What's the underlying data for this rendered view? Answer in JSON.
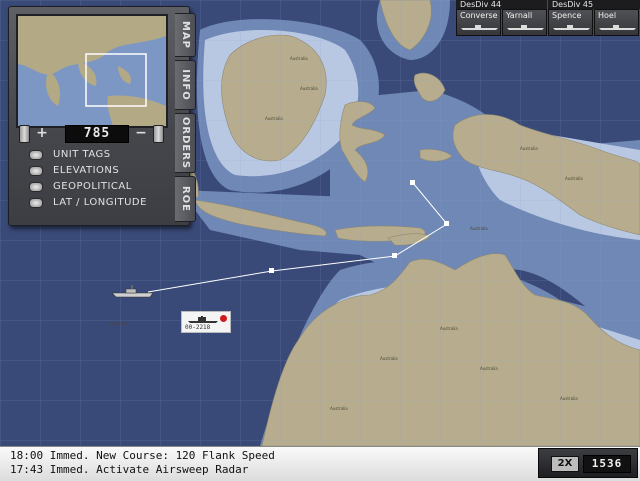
{
  "map": {
    "colors": {
      "deep_ocean": "#3a4a78",
      "shallow_ocean": "#6f88b6",
      "coast": "#b9c8e2",
      "land": "#b7ad8e"
    },
    "place_label": "Australia",
    "waypoints_route": "player-course"
  },
  "panel": {
    "tabs": [
      "MAP",
      "INFO",
      "ORDERS",
      "ROE"
    ],
    "zoom": {
      "minus": "+",
      "plus": "−",
      "value": "785"
    },
    "layers": [
      {
        "label": "UNIT TAGS",
        "icon": "led-indicator-icon"
      },
      {
        "label": "ELEVATIONS",
        "icon": "led-indicator-icon"
      },
      {
        "label": "GEOPOLITICAL",
        "icon": "led-indicator-icon"
      },
      {
        "label": "LAT / LONGITUDE",
        "icon": "led-indicator-icon"
      }
    ]
  },
  "fleet": {
    "divisions": [
      {
        "name": "DesDiv 44",
        "ships": [
          "Converse",
          "Yarnall"
        ]
      },
      {
        "name": "DesDiv 45",
        "ships": [
          "Spence",
          "Hoel"
        ]
      }
    ]
  },
  "contact": {
    "flag": "red-circle-icon",
    "id": "00-2218"
  },
  "messages": [
    "18:00 Immed. New Course: 120 Flank Speed",
    "17:43 Immed. Activate Airsweep Radar"
  ],
  "time": {
    "speed": "2X",
    "clock": "1536"
  }
}
